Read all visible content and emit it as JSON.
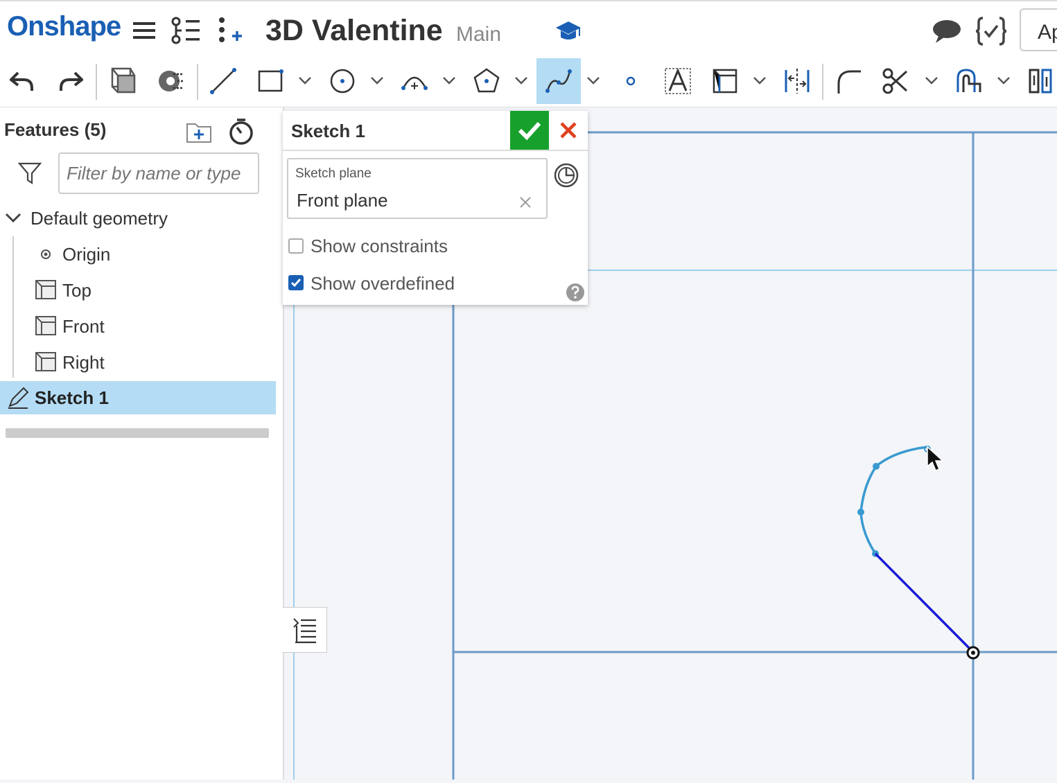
{
  "header": {
    "logo": "Onshape",
    "document_title": "3D Valentine",
    "branch": "Main",
    "app_button": "Ap"
  },
  "toolbar": {
    "tools": [
      "undo",
      "redo",
      "view-cube",
      "use-sketch",
      "line",
      "rectangle",
      "circle",
      "arc",
      "polygon",
      "spline",
      "point",
      "text",
      "construction",
      "symmetric",
      "fillet",
      "trim",
      "offset",
      "transform"
    ],
    "active_tool": "spline"
  },
  "features": {
    "title": "Features (5)",
    "filter_placeholder": "Filter by name or type",
    "default_geometry_label": "Default geometry",
    "items": [
      {
        "label": "Origin"
      },
      {
        "label": "Top"
      },
      {
        "label": "Front"
      },
      {
        "label": "Right"
      }
    ],
    "selected_feature": "Sketch 1"
  },
  "sketch_dialog": {
    "title": "Sketch 1",
    "plane_label": "Sketch plane",
    "plane_value": "Front plane",
    "show_constraints_label": "Show constraints",
    "show_constraints_checked": false,
    "show_overdefined_label": "Show overdefined",
    "show_overdefined_checked": true
  },
  "colors": {
    "brand": "#1a5fb4",
    "accept": "#17a12c",
    "cancel": "#e0401d",
    "selection": "#b4dcf4",
    "spline": "#3a9ad0",
    "line": "#1a1ad6",
    "plane_edge": "#6b9ac8"
  }
}
